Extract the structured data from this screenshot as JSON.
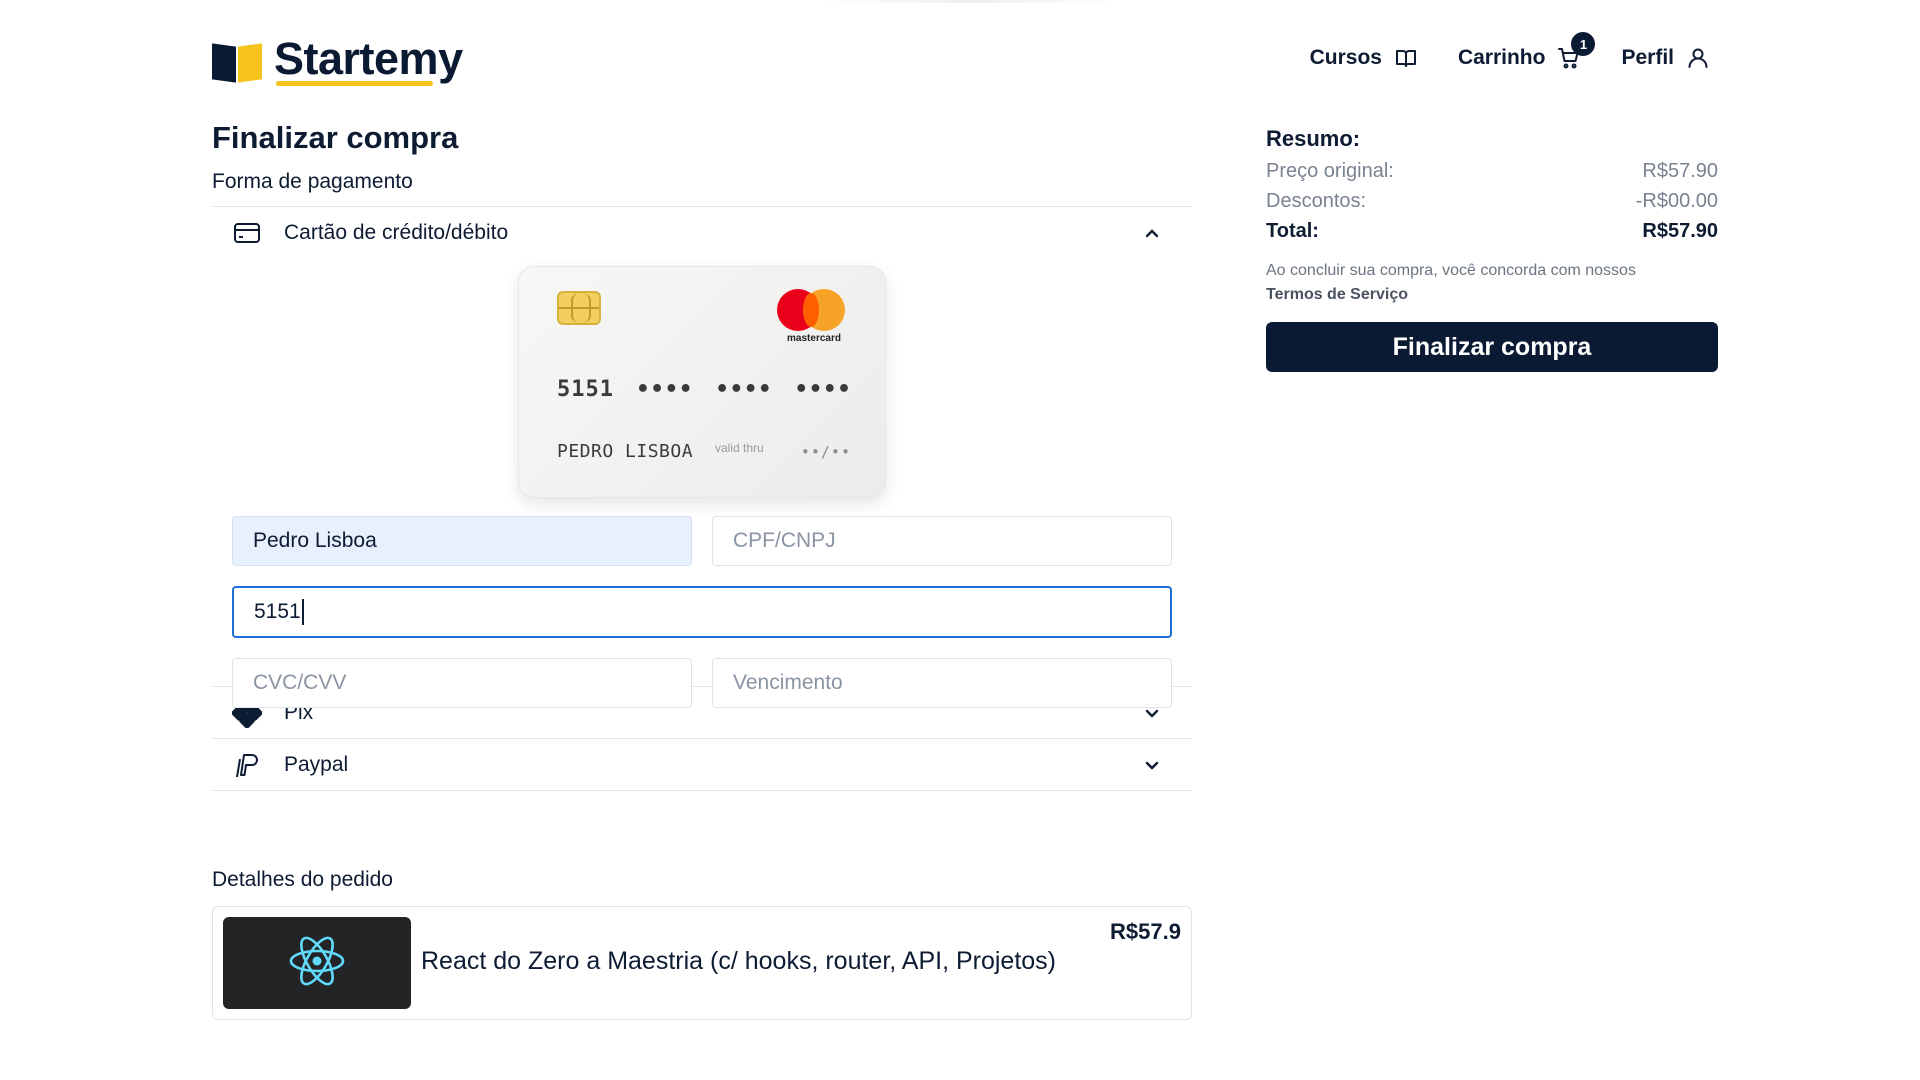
{
  "brand": {
    "name": "Startemy"
  },
  "nav": {
    "courses_label": "Cursos",
    "cart_label": "Carrinho",
    "cart_count": "1",
    "profile_label": "Perfil"
  },
  "checkout": {
    "title": "Finalizar compra",
    "payment_label": "Forma de pagamento",
    "methods": [
      {
        "label": "Cartão de crédito/débito",
        "icon": "credit-card-icon",
        "expanded": true
      },
      {
        "label": "Pix",
        "icon": "pix-icon",
        "expanded": false
      },
      {
        "label": "Paypal",
        "icon": "paypal-icon",
        "expanded": false
      }
    ]
  },
  "card_preview": {
    "brand": "mastercard",
    "number": "5151 •••• •••• ••••",
    "holder": "PEDRO LISBOA",
    "valid_thru_label": "valid thru",
    "expiry": "••/••"
  },
  "form": {
    "name_value": "Pedro Lisboa",
    "cpf_placeholder": "CPF/CNPJ",
    "card_number_value": "5151",
    "cvc_placeholder": "CVC/CVV",
    "expiry_placeholder": "Vencimento"
  },
  "order": {
    "label": "Detalhes do pedido",
    "items": [
      {
        "title": "React do Zero a Maestria (c/ hooks, router, API, Projetos)",
        "price": "R$57.9",
        "thumbnail_icon": "react-icon"
      }
    ]
  },
  "summary": {
    "title": "Resumo:",
    "original_label": "Preço original:",
    "original_value": "R$57.90",
    "discount_label": "Descontos:",
    "discount_value": "-R$00.00",
    "total_label": "Total:",
    "total_value": "R$57.90",
    "terms_text": "Ao concluir sua compra, você concorda com nossos",
    "terms_link": "Termos de Serviço",
    "checkout_button": "Finalizar compra"
  },
  "colors": {
    "navy": "#0b1a33",
    "accent_yellow": "#f6c31b",
    "focus_blue": "#1f6fd6",
    "autofill_bg": "#e8f0fd"
  }
}
